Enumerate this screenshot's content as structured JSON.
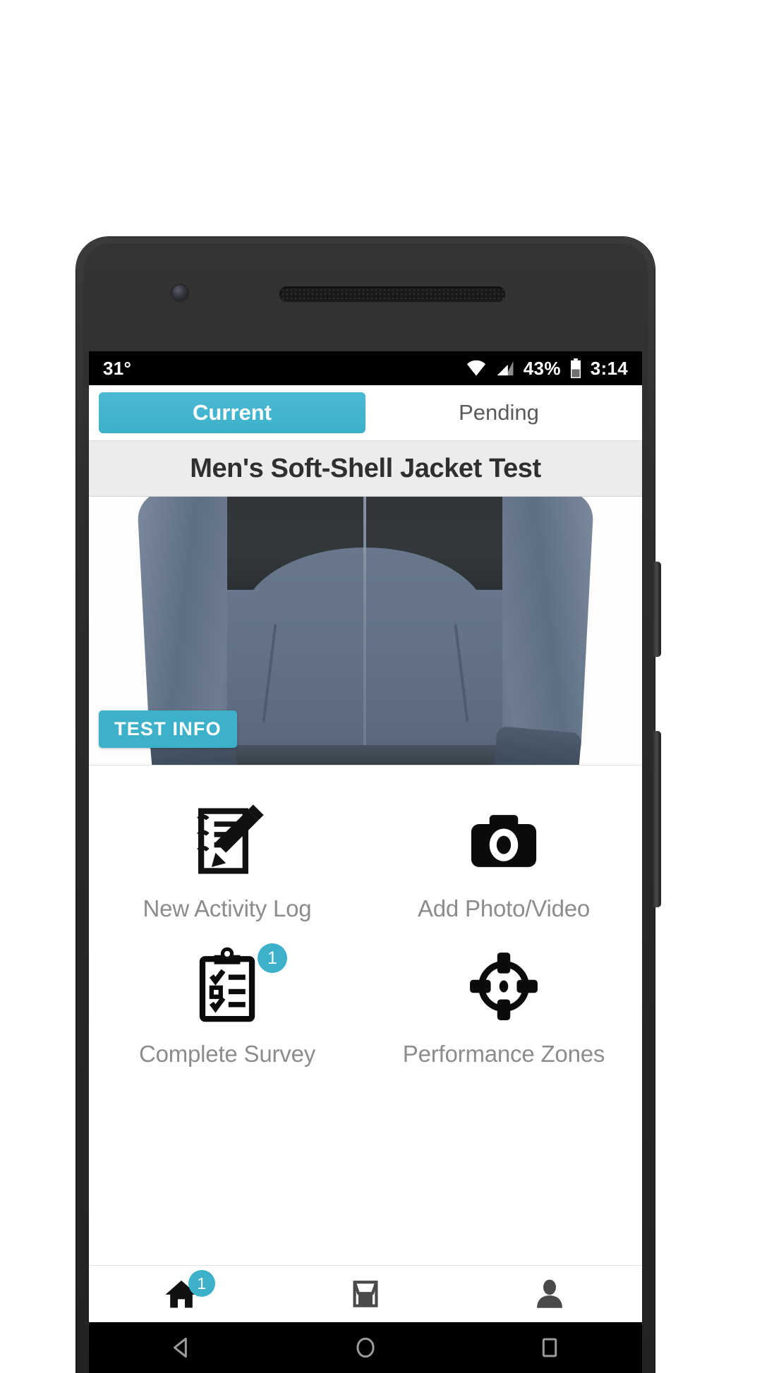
{
  "status_bar": {
    "temperature": "31°",
    "wifi_icon": "wifi-icon",
    "signal_icon": "cell-signal-icon",
    "battery_percent": "43%",
    "battery_icon": "battery-icon",
    "clock": "3:14"
  },
  "tabs": [
    {
      "label": "Current",
      "active": true
    },
    {
      "label": "Pending",
      "active": false
    }
  ],
  "header": {
    "title": "Men's Soft-Shell Jacket Test"
  },
  "hero": {
    "image_alt": "soft-shell-jacket-photo",
    "test_info_label": "TEST INFO"
  },
  "actions": [
    {
      "label": "New Activity Log",
      "icon": "notepad-pencil-icon",
      "badge": null
    },
    {
      "label": "Add Photo/Video",
      "icon": "camera-icon",
      "badge": null
    },
    {
      "label": "Complete Survey",
      "icon": "clipboard-checklist-icon",
      "badge": "1"
    },
    {
      "label": "Performance Zones",
      "icon": "crosshair-target-icon",
      "badge": null
    }
  ],
  "bottom_nav": [
    {
      "icon": "home-icon",
      "badge": "1"
    },
    {
      "icon": "inbox-tray-icon",
      "badge": null
    },
    {
      "icon": "person-profile-icon",
      "badge": null
    }
  ],
  "android_nav": [
    {
      "icon": "back-triangle-icon"
    },
    {
      "icon": "home-circle-icon"
    },
    {
      "icon": "recents-square-icon"
    }
  ],
  "colors": {
    "accent": "#3db1ca",
    "accent_light": "#4cb9d4",
    "title_bar_bg": "#ececec",
    "label_grey": "#8c8c8c",
    "status_bar_bg": "#000000"
  }
}
